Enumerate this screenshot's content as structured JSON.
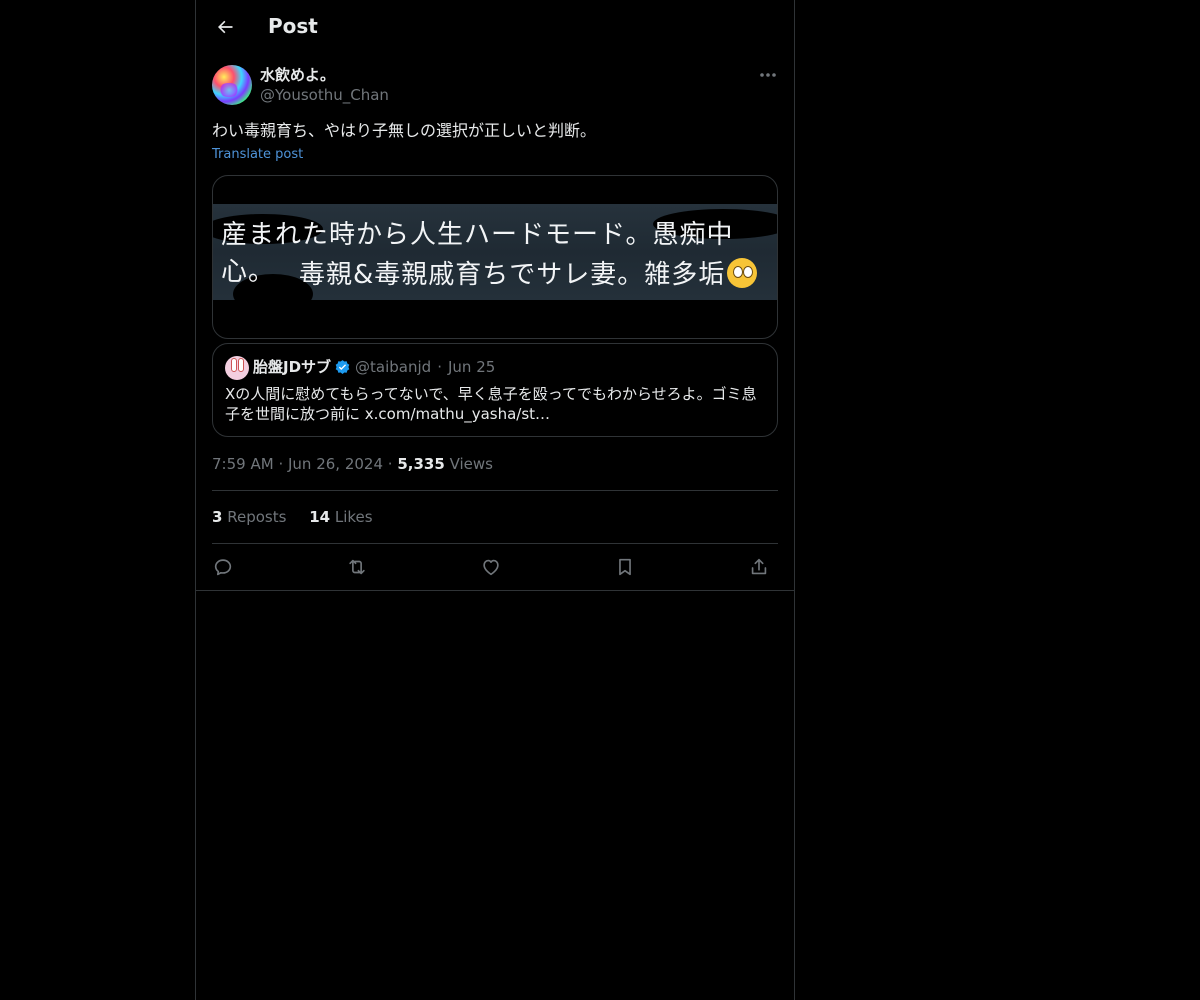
{
  "header": {
    "back_icon": "arrow-left-icon",
    "title": "Post"
  },
  "tweet": {
    "author_name": "水飲めよ。",
    "author_handle": "@Yousothu_Chan",
    "more_icon": "ellipsis-icon",
    "text": "わい毒親育ち、やはり子無しの選択が正しいと判断。",
    "translate_label": "Translate post",
    "media": {
      "line1": "産まれた時から人生ハードモード。愚痴中心。",
      "line2": "毒親&毒親戚育ちでサレ妻。雑多垢",
      "emoji": "eye-roll-emoji"
    },
    "timestamp": "7:59 AM",
    "date": "Jun 26, 2024",
    "views_count": "5,335",
    "views_label": "Views",
    "reposts_count": "3",
    "reposts_label": "Reposts",
    "likes_count": "14",
    "likes_label": "Likes"
  },
  "quote": {
    "author_name": "胎盤JDサブ",
    "verified_icon": "verified-badge-icon",
    "author_handle": "@taibanjd",
    "date": "Jun 25",
    "text": "Xの人間に慰めてもらってないで、早く息子を殴ってでもわからせろよ。ゴミ息子を世間に放つ前に x.com/mathu_yasha/st…"
  },
  "actions": [
    {
      "name": "reply",
      "icon": "reply-icon"
    },
    {
      "name": "repost",
      "icon": "repost-icon"
    },
    {
      "name": "like",
      "icon": "heart-icon"
    },
    {
      "name": "bookmark",
      "icon": "bookmark-icon"
    },
    {
      "name": "share",
      "icon": "share-icon"
    }
  ],
  "colors": {
    "background": "#000000",
    "border": "#2f3336",
    "text": "#e7e9ea",
    "muted": "#71767b",
    "link": "#4e93d8",
    "verified": "#1d9bf0"
  }
}
